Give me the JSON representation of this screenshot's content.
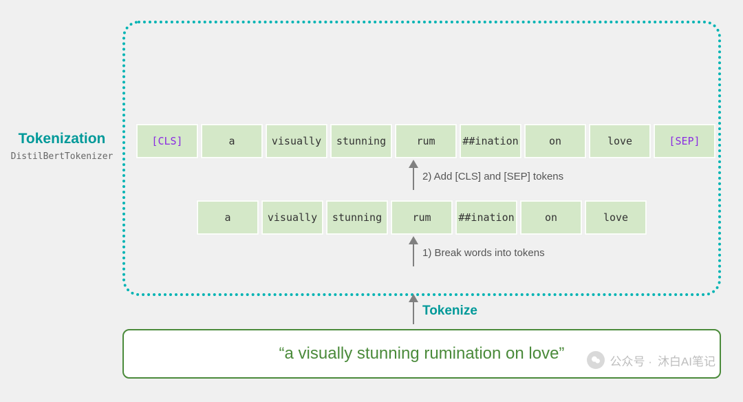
{
  "labels": {
    "title": "Tokenization",
    "subtitle": "DistilBertTokenizer"
  },
  "tokens_row_top": [
    {
      "text": "[CLS]",
      "special": true
    },
    {
      "text": "a",
      "special": false
    },
    {
      "text": "visually",
      "special": false
    },
    {
      "text": "stunning",
      "special": false
    },
    {
      "text": "rum",
      "special": false
    },
    {
      "text": "##ination",
      "special": false
    },
    {
      "text": "on",
      "special": false
    },
    {
      "text": "love",
      "special": false
    },
    {
      "text": "[SEP]",
      "special": true
    }
  ],
  "tokens_row_mid": [
    {
      "text": "a",
      "special": false
    },
    {
      "text": "visually",
      "special": false
    },
    {
      "text": "stunning",
      "special": false
    },
    {
      "text": "rum",
      "special": false
    },
    {
      "text": "##ination",
      "special": false
    },
    {
      "text": "on",
      "special": false
    },
    {
      "text": "love",
      "special": false
    }
  ],
  "steps": {
    "step2": "2) Add [CLS] and [SEP] tokens",
    "step1": "1) Break words into tokens",
    "tokenize": "Tokenize"
  },
  "input_sentence": "“a visually stunning rumination on love”",
  "watermark": {
    "prefix": "公众号 ·",
    "name": "沐白AI笔记"
  }
}
